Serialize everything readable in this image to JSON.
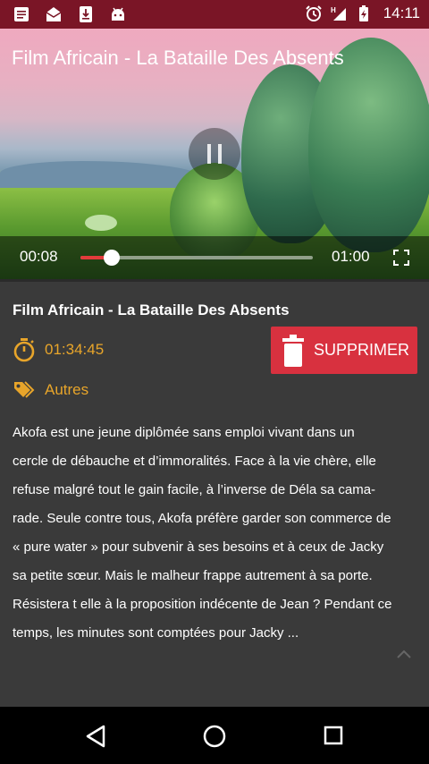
{
  "status_bar": {
    "time": "14:11",
    "left_icons": [
      "document-icon",
      "mail-open-icon",
      "download-icon",
      "android-icon"
    ],
    "right_icons": [
      "alarm-icon",
      "signal-h-icon",
      "battery-charging-icon"
    ],
    "color": "#7a1526"
  },
  "player": {
    "title": "Film Africain - La Bataille Des Absents",
    "current_time": "00:08",
    "duration": "01:00",
    "progress": 0.133,
    "accent": "#e23b3b",
    "state": "playing"
  },
  "details": {
    "title": "Film Africain - La Bataille Des Absents",
    "duration": "01:34:45",
    "category": "Autres",
    "delete_label": "SUPPRIMER",
    "accent": "#e8a52a",
    "delete_color": "#d8313f",
    "description": [
      "Akofa est une jeune diplômée sans emploi vivant dans un",
      "cercle de débauche et d’immoralités. Face à la vie chère, elle",
      "refuse malgré tout le gain facile, à l’inverse de Déla sa cama-",
      "rade. Seule contre tous, Akofa préfère garder son commerce de",
      "« pure water » pour subvenir à ses besoins et à ceux de Jacky",
      "sa petite sœur. Mais le malheur frappe autrement à sa porte.",
      "Résistera t elle à la proposition indécente de Jean ? Pendant ce",
      "temps, les minutes sont comptées pour Jacky ..."
    ]
  },
  "nav": {
    "icons": [
      "back-triangle-icon",
      "home-circle-icon",
      "recents-square-icon"
    ]
  }
}
